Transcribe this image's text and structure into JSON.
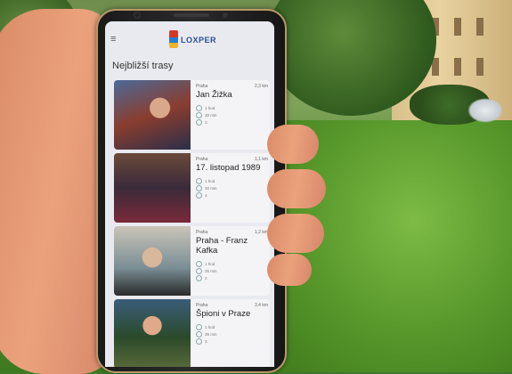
{
  "app": {
    "logo_text": "LOXPER",
    "logo_sub": "",
    "back_glyph": "≡",
    "section_title": "Nejbližší trasy"
  },
  "cards": [
    {
      "city": "Praha",
      "distance": "2,3 km",
      "title": "Jan Žižka",
      "m1": "1 hod",
      "m2": "30 min",
      "m3": "3"
    },
    {
      "city": "Praha",
      "distance": "1,1 km",
      "title": "17. listopad 1989",
      "m1": "1 hod",
      "m2": "30 min",
      "m3": "4"
    },
    {
      "city": "Praha",
      "distance": "1,2 km",
      "title": "Praha - Franz Kafka",
      "m1": "1 hod",
      "m2": "25 min",
      "m3": "2"
    },
    {
      "city": "Praha",
      "distance": "3,4 km",
      "title": "Špioni v Praze",
      "m1": "1 hod",
      "m2": "35 min",
      "m3": "3"
    }
  ]
}
